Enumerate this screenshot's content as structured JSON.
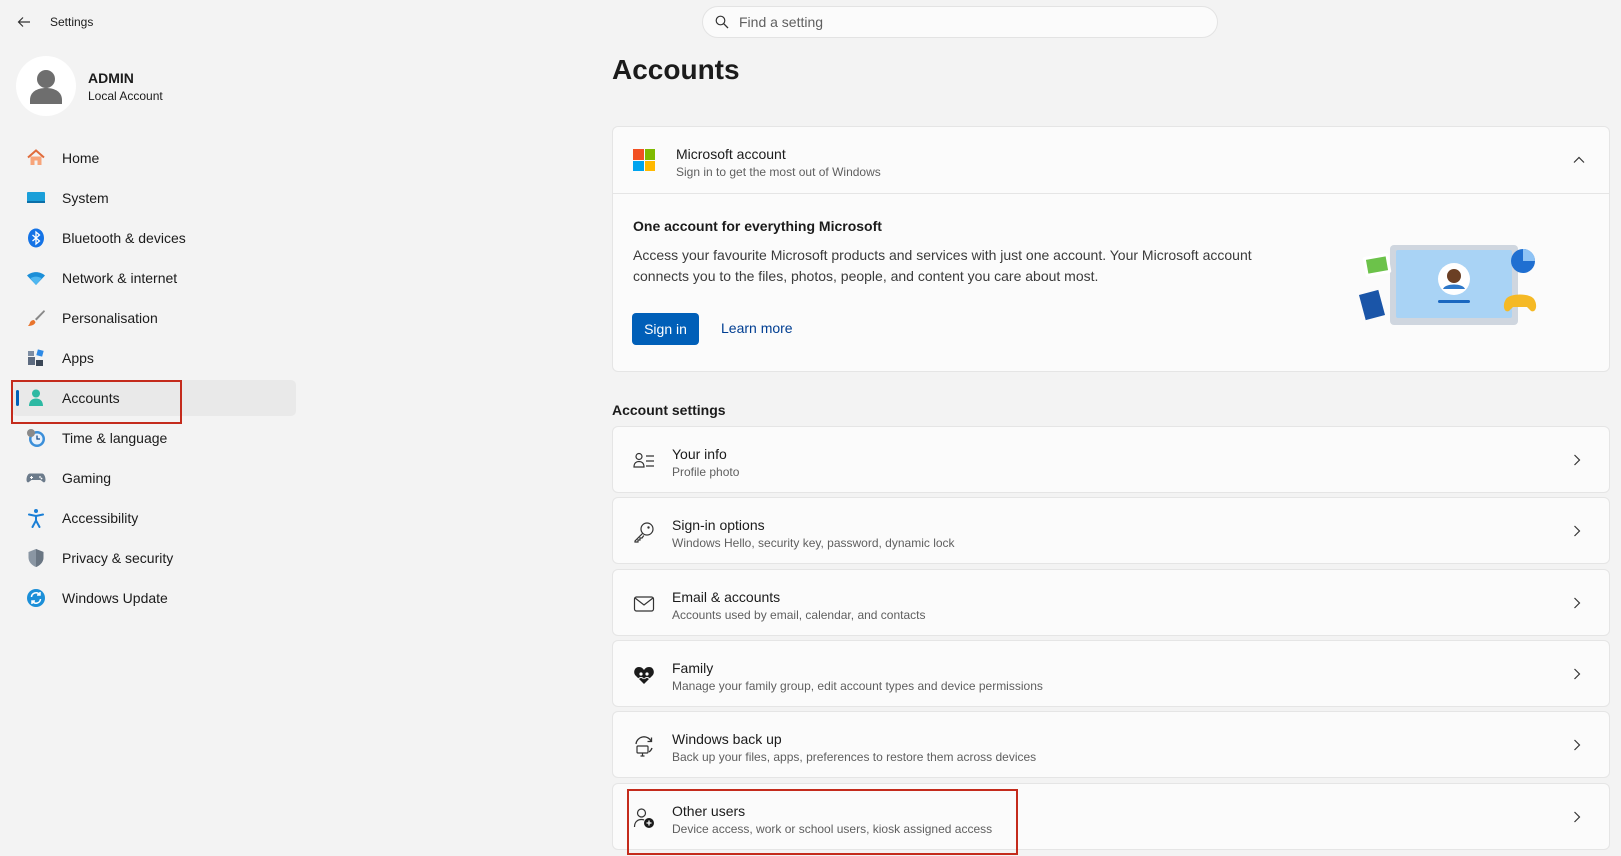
{
  "app": {
    "title": "Settings"
  },
  "search": {
    "placeholder": "Find a setting"
  },
  "profile": {
    "name": "ADMIN",
    "account_type": "Local Account"
  },
  "nav": {
    "items": [
      {
        "label": "Home",
        "icon": "home-icon"
      },
      {
        "label": "System",
        "icon": "system-icon"
      },
      {
        "label": "Bluetooth & devices",
        "icon": "bluetooth-icon"
      },
      {
        "label": "Network & internet",
        "icon": "wifi-icon"
      },
      {
        "label": "Personalisation",
        "icon": "brush-icon"
      },
      {
        "label": "Apps",
        "icon": "apps-icon"
      },
      {
        "label": "Accounts",
        "icon": "accounts-icon",
        "active": true
      },
      {
        "label": "Time & language",
        "icon": "time-language-icon"
      },
      {
        "label": "Gaming",
        "icon": "gamepad-icon"
      },
      {
        "label": "Accessibility",
        "icon": "accessibility-icon"
      },
      {
        "label": "Privacy & security",
        "icon": "shield-icon"
      },
      {
        "label": "Windows Update",
        "icon": "update-icon"
      }
    ]
  },
  "main": {
    "title": "Accounts",
    "microsoft_account": {
      "title": "Microsoft account",
      "subtitle": "Sign in to get the most out of Windows",
      "body_title": "One account for everything Microsoft",
      "body_text": "Access your favourite Microsoft products and services with just one account. Your Microsoft account connects you to the files, photos, people, and content you care about most.",
      "sign_in_label": "Sign in",
      "learn_more_label": "Learn more"
    },
    "section_label": "Account settings",
    "rows": [
      {
        "title": "Your info",
        "subtitle": "Profile photo",
        "icon": "your-info-icon"
      },
      {
        "title": "Sign-in options",
        "subtitle": "Windows Hello, security key, password, dynamic lock",
        "icon": "key-icon"
      },
      {
        "title": "Email & accounts",
        "subtitle": "Accounts used by email, calendar, and contacts",
        "icon": "mail-icon"
      },
      {
        "title": "Family",
        "subtitle": "Manage your family group, edit account types and device permissions",
        "icon": "family-heart-icon"
      },
      {
        "title": "Windows back up",
        "subtitle": "Back up your files, apps, preferences to restore them across devices",
        "icon": "backup-icon"
      },
      {
        "title": "Other users",
        "subtitle": "Device access, work or school users, kiosk assigned access",
        "icon": "add-user-icon"
      }
    ]
  },
  "colors": {
    "accent": "#005fb8",
    "highlight_box": "#c42b1c",
    "background": "#f3f3f3",
    "card": "#fbfbfb"
  }
}
